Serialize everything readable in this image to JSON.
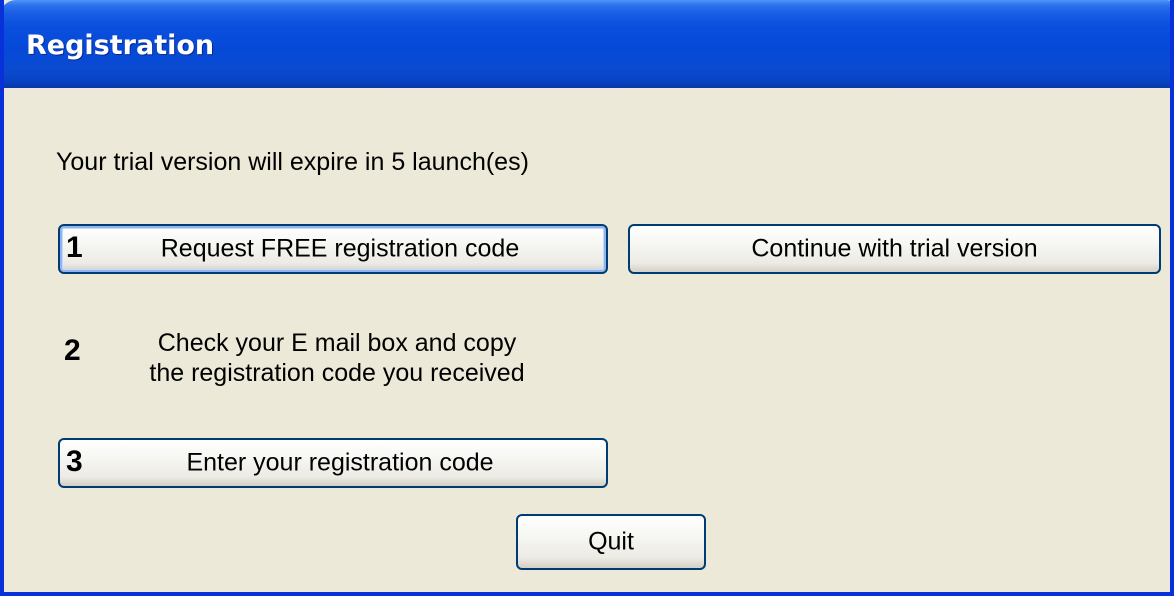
{
  "window": {
    "title": "Registration"
  },
  "main": {
    "expire_message": "Your trial version will expire in 5 launch(es)",
    "step1": {
      "number": "1",
      "button_label": "Request FREE registration code"
    },
    "continue_label": "Continue with trial version",
    "step2": {
      "number": "2",
      "line1": "Check your E mail box and copy",
      "line2": "the registration code you received"
    },
    "step3": {
      "number": "3",
      "button_label": "Enter your registration code"
    },
    "quit_label": "Quit"
  },
  "colors": {
    "titlebar_blue": "#0549d8",
    "dialog_background": "#ece9d8",
    "button_border": "#003c74"
  }
}
